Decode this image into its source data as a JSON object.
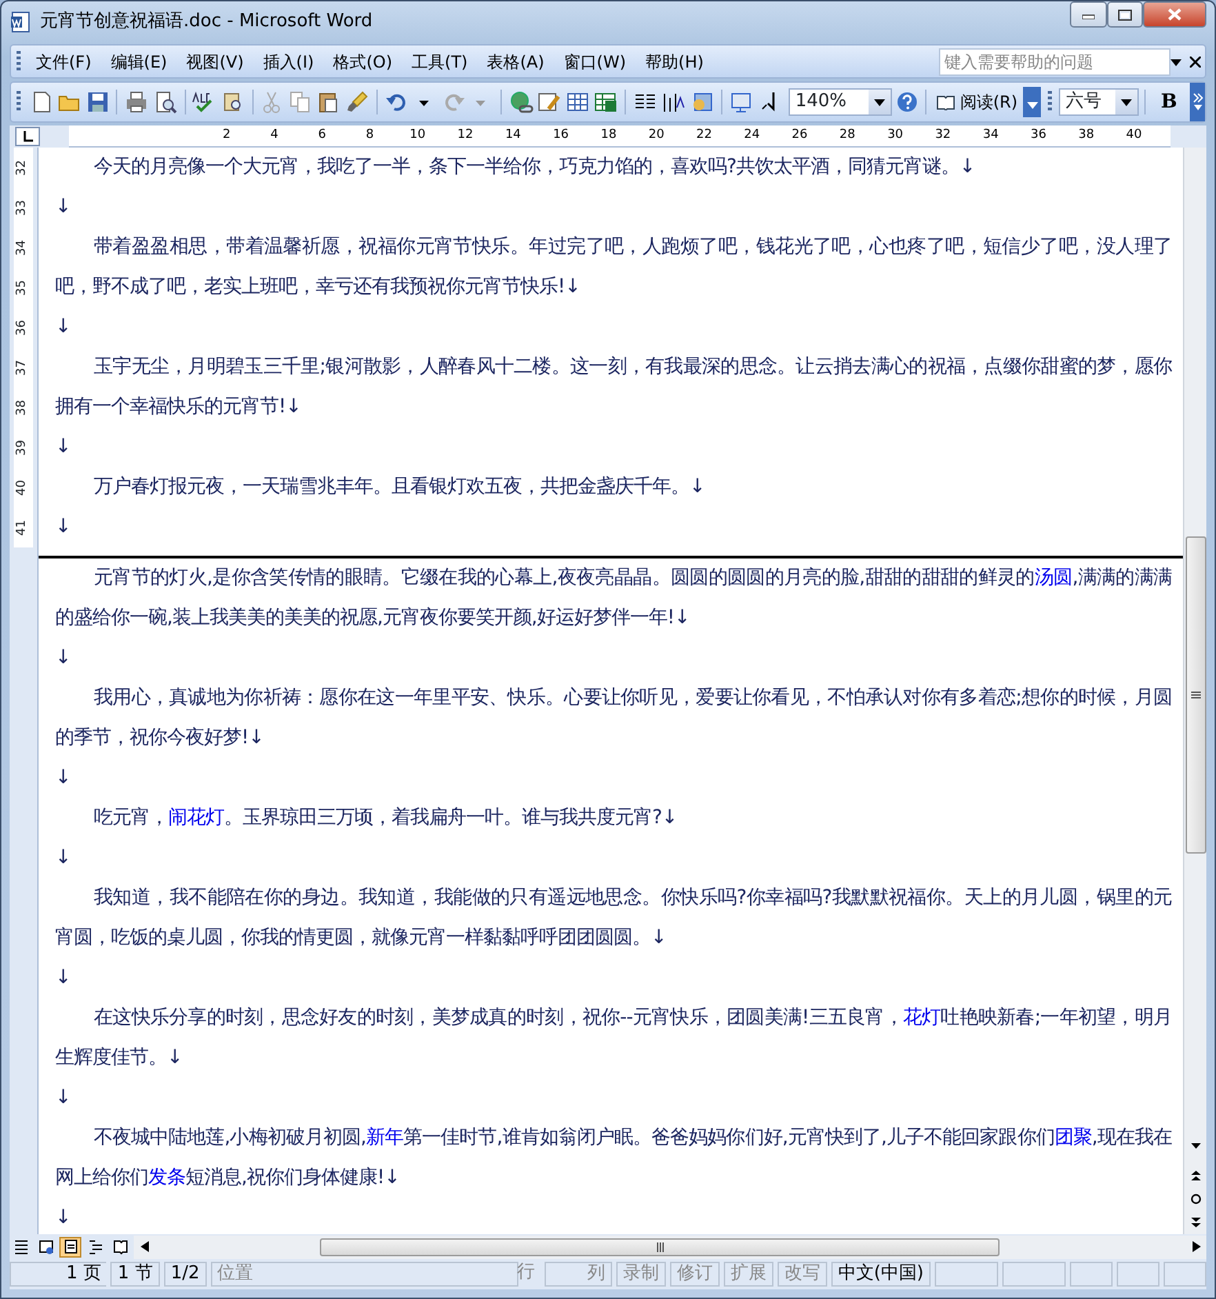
{
  "window": {
    "title": "元宵节创意祝福语.doc - Microsoft Word"
  },
  "menu": [
    "文件(F)",
    "编辑(E)",
    "视图(V)",
    "插入(I)",
    "格式(O)",
    "工具(T)",
    "表格(A)",
    "窗口(W)",
    "帮助(H)"
  ],
  "help_box": {
    "placeholder": "键入需要帮助的问题"
  },
  "toolbar": {
    "zoom": "140%",
    "reading_button": "阅读(R)",
    "font_size": "六号",
    "bold_button": "B"
  },
  "ruler": {
    "numbers": [
      "2",
      "4",
      "6",
      "8",
      "10",
      "12",
      "14",
      "16",
      "18",
      "20",
      "22",
      "24",
      "26",
      "28",
      "30",
      "32",
      "34",
      "36",
      "38",
      "40"
    ],
    "vertical_numbers": [
      "32",
      "33",
      "34",
      "35",
      "36",
      "37",
      "38",
      "39",
      "40",
      "41"
    ]
  },
  "pages": [
    {
      "paragraphs": [
        {
          "kind": "body",
          "segments": [
            {
              "text": "今天的月亮像一个大元宵，我吃了一半，条下一半给你，巧克力馅的，喜欢吗?共饮太平酒，同猜元宵谜。↓",
              "highlighted": false
            }
          ]
        },
        {
          "kind": "empty",
          "segments": [
            {
              "text": "↓",
              "highlighted": false
            }
          ]
        },
        {
          "kind": "body",
          "segments": [
            {
              "text": "带着盈盈相思，带着温馨祈愿，祝福你元宵节快乐。年过完了吧，人跑烦了吧，钱花光了吧，心也疼了吧，短信少了吧，没人理了吧，野不成了吧，老实上班吧，幸亏还有我预祝你元宵节快乐!↓",
              "highlighted": false
            }
          ]
        },
        {
          "kind": "empty",
          "segments": [
            {
              "text": "↓",
              "highlighted": false
            }
          ]
        },
        {
          "kind": "body",
          "segments": [
            {
              "text": "玉宇无尘，月明碧玉三千里;银河散影，人醉春风十二楼。这一刻，有我最深的思念。让云捎去满心的祝福，点缀你甜蜜的梦，愿你拥有一个幸福快乐的元宵节!↓",
              "highlighted": false
            }
          ]
        },
        {
          "kind": "empty",
          "segments": [
            {
              "text": "↓",
              "highlighted": false
            }
          ]
        },
        {
          "kind": "body",
          "segments": [
            {
              "text": "万户春灯报元夜，一天瑞雪兆丰年。且看银灯欢五夜，共把金盏庆千年。↓",
              "highlighted": false
            }
          ]
        },
        {
          "kind": "empty",
          "segments": [
            {
              "text": "↓",
              "highlighted": false
            }
          ]
        }
      ]
    },
    {
      "paragraphs": [
        {
          "kind": "body",
          "segments": [
            {
              "text": "元宵节的灯火,是你含笑传情的眼睛。它缀在我的心幕上,夜夜亮晶晶。圆圆的圆圆的月亮的脸,甜甜的甜甜的鲜灵的",
              "highlighted": false
            },
            {
              "text": "汤圆",
              "highlighted": true
            },
            {
              "text": ",满满的满满的盛给你一碗,装上我美美的美美的祝愿,元宵夜你要笑开颜,好运好梦伴一年!↓",
              "highlighted": false
            }
          ]
        },
        {
          "kind": "empty",
          "segments": [
            {
              "text": "↓",
              "highlighted": false
            }
          ]
        },
        {
          "kind": "body",
          "segments": [
            {
              "text": "我用心，真诚地为你祈祷：愿你在这一年里平安、快乐。心要让你听见，爱要让你看见，不怕承认对你有多着恋;想你的时候，月圆的季节，祝你今夜好梦!↓",
              "highlighted": false
            }
          ]
        },
        {
          "kind": "empty",
          "segments": [
            {
              "text": "↓",
              "highlighted": false
            }
          ]
        },
        {
          "kind": "body",
          "segments": [
            {
              "text": "吃元宵，",
              "highlighted": false
            },
            {
              "text": "闹花灯",
              "highlighted": true
            },
            {
              "text": "。玉界琼田三万顷，着我扁舟一叶。谁与我共度元宵?↓",
              "highlighted": false
            }
          ]
        },
        {
          "kind": "empty",
          "segments": [
            {
              "text": "↓",
              "highlighted": false
            }
          ]
        },
        {
          "kind": "body",
          "segments": [
            {
              "text": "我知道，我不能陪在你的身边。我知道，我能做的只有遥远地思念。你快乐吗?你幸福吗?我默默祝福你。天上的月儿圆，锅里的元宵圆，吃饭的桌儿圆，你我的情更圆，就像元宵一样黏黏呼呼团团圆圆。↓",
              "highlighted": false
            }
          ]
        },
        {
          "kind": "empty",
          "segments": [
            {
              "text": "↓",
              "highlighted": false
            }
          ]
        },
        {
          "kind": "body",
          "segments": [
            {
              "text": "在这快乐分享的时刻，思念好友的时刻，美梦成真的时刻，祝你--元宵快乐，团圆美满!三五良宵，",
              "highlighted": false
            },
            {
              "text": "花灯",
              "highlighted": true
            },
            {
              "text": "吐艳映新春;一年初望，明月生辉度佳节。↓",
              "highlighted": false
            }
          ]
        },
        {
          "kind": "empty",
          "segments": [
            {
              "text": "↓",
              "highlighted": false
            }
          ]
        },
        {
          "kind": "body",
          "segments": [
            {
              "text": "不夜城中陆地莲,小梅初破月初圆,",
              "highlighted": false
            },
            {
              "text": "新年",
              "highlighted": true
            },
            {
              "text": "第一佳时节,谁肯如翁闭户眠。爸爸妈妈你们好,元宵快到了,儿子不能回家跟你们",
              "highlighted": false
            },
            {
              "text": "团聚",
              "highlighted": true
            },
            {
              "text": ",现在我在网上给你们",
              "highlighted": false
            },
            {
              "text": "发条",
              "highlighted": true
            },
            {
              "text": "短消息,祝你们身体健康!↓",
              "highlighted": false
            }
          ]
        },
        {
          "kind": "empty",
          "segments": [
            {
              "text": "↓",
              "highlighted": false
            }
          ]
        }
      ]
    }
  ],
  "view_modes": [
    {
      "selected": false
    },
    {
      "selected": false
    },
    {
      "selected": true
    },
    {
      "selected": false
    },
    {
      "selected": false
    }
  ],
  "status_bar": [
    {
      "text": "1 页",
      "disabled": false
    },
    {
      "text": "1 节",
      "disabled": false
    },
    {
      "text": "1/2",
      "disabled": false
    },
    {
      "text": "位置",
      "disabled": true
    },
    {
      "text": "行",
      "disabled": true
    },
    {
      "text": "列",
      "disabled": true
    },
    {
      "text": "录制",
      "disabled": true
    },
    {
      "text": "修订",
      "disabled": true
    },
    {
      "text": "扩展",
      "disabled": true
    },
    {
      "text": "改写",
      "disabled": true
    },
    {
      "text": "中文(中国)",
      "disabled": false
    }
  ]
}
